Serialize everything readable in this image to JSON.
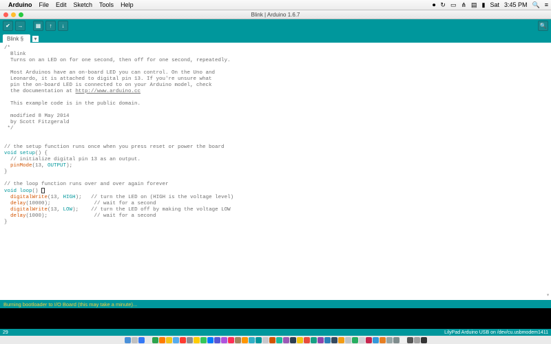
{
  "menubar": {
    "app": "Arduino",
    "items": [
      "File",
      "Edit",
      "Sketch",
      "Tools",
      "Help"
    ],
    "right": {
      "day": "Sat",
      "time": "3:45 PM"
    }
  },
  "window": {
    "title": "Blink | Arduino 1.6.7"
  },
  "tab": {
    "name": "Blink §"
  },
  "code": {
    "l1": "/*",
    "l2": "  Blink",
    "l3": "  Turns on an LED on for one second, then off for one second, repeatedly.",
    "l4": "",
    "l5": "  Most Arduinos have an on-board LED you can control. On the Uno and",
    "l6": "  Leonardo, it is attached to digital pin 13. If you're unsure what",
    "l7": "  pin the on-board LED is connected to on your Arduino model, check",
    "l8a": "  the documentation at ",
    "l8b": "http://www.arduino.cc",
    "l9": "",
    "l10": "  This example code is in the public domain.",
    "l11": "",
    "l12": "  modified 8 May 2014",
    "l13": "  by Scott Fitzgerald",
    "l14": " */",
    "l15": "",
    "l16": "",
    "l17": "// the setup function runs once when you press reset or power the board",
    "l18a": "void",
    "l18b": " ",
    "l18c": "setup",
    "l18d": "() {",
    "l19": "  // initialize digital pin 13 as an output.",
    "l20a": "  ",
    "l20b": "pinMode",
    "l20c": "(13, ",
    "l20d": "OUTPUT",
    "l20e": ");",
    "l21": "}",
    "l22": "",
    "l23": "// the loop function runs over and over again forever",
    "l24a": "void",
    "l24b": " ",
    "l24c": "loop",
    "l24d": "() ",
    "l25a": "  ",
    "l25b": "digitalWrite",
    "l25c": "(13, ",
    "l25d": "HIGH",
    "l25e": ");   // turn the LED on (HIGH is the voltage level)",
    "l26a": "  ",
    "l26b": "delay",
    "l26c": "(10000);              // wait for a second",
    "l27a": "  ",
    "l27b": "digitalWrite",
    "l27c": "(13, ",
    "l27d": "LOW",
    "l27e": ");    // turn the LED off by making the voltage LOW",
    "l28a": "  ",
    "l28b": "delay",
    "l28c": "(1000);               // wait for a second",
    "l29": "}"
  },
  "status": {
    "msg": "Burning bootloader to I/O Board (this may take a minute)..."
  },
  "footer": {
    "line": "29",
    "board": "LilyPad Arduino USB on /dev/cu.usbmodem1411"
  },
  "dock_colors": [
    "#4a90d9",
    "#c0c0c0",
    "#3478f6",
    "#e8e8e8",
    "#2da44e",
    "#ff7b00",
    "#f5c518",
    "#55acee",
    "#ff3b30",
    "#8e8e93",
    "#ffcc00",
    "#34c759",
    "#007aff",
    "#5856d6",
    "#af52de",
    "#ff2d55",
    "#a2845e",
    "#ff9500",
    "#30b0c7",
    "#00979c",
    "#c7c7cc",
    "#d35400",
    "#1abc9c",
    "#9b59b6",
    "#2c3e50",
    "#f1c40f",
    "#e74c3c",
    "#16a085",
    "#8e44ad",
    "#2980b9",
    "#34495e",
    "#f39c12",
    "#bdc3c7",
    "#27ae60",
    "#d1d1d6",
    "#c7254e",
    "#3498db",
    "#e67e22",
    "#95a5a6",
    "#7f8c8d",
    "#f0f0f0",
    "#555555",
    "#a0a0a0",
    "#333333"
  ]
}
